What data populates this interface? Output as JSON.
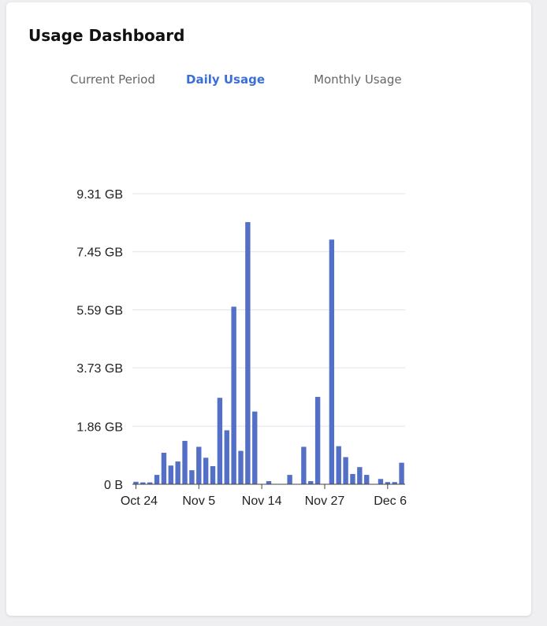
{
  "title": "Usage Dashboard",
  "tabs": [
    {
      "label": "Current Period",
      "active": false
    },
    {
      "label": "Daily Usage",
      "active": true
    },
    {
      "label": "Monthly Usage",
      "active": false
    }
  ],
  "colors": {
    "accent": "#3b6fd6",
    "bar": "#5470c6",
    "grid": "#e0e3ea"
  },
  "chart_data": {
    "type": "bar",
    "ylim": [
      0,
      9.31
    ],
    "ytick_values": [
      0,
      1.86,
      3.73,
      5.59,
      7.45,
      9.31
    ],
    "ytick_labels": [
      "0 B",
      "1.86 GB",
      "3.73 GB",
      "5.59 GB",
      "7.45 GB",
      "9.31 GB"
    ],
    "xtick_labels": [
      "Oct 24",
      "Nov 5",
      "Nov 14",
      "Nov 27",
      "Dec 6"
    ],
    "xtick_index": [
      0,
      9,
      18,
      27,
      36
    ],
    "values": [
      0.08,
      0.06,
      0.06,
      0.3,
      1.01,
      0.6,
      0.73,
      1.39,
      0.45,
      1.2,
      0.85,
      0.58,
      2.77,
      1.73,
      5.69,
      1.07,
      8.4,
      2.33,
      0,
      0.1,
      0,
      0,
      0.3,
      0,
      1.2,
      0.1,
      2.8,
      0,
      7.84,
      1.22,
      0.87,
      0.33,
      0.55,
      0.3,
      0,
      0.17,
      0.07,
      0.07,
      0.69
    ],
    "grid": true
  }
}
